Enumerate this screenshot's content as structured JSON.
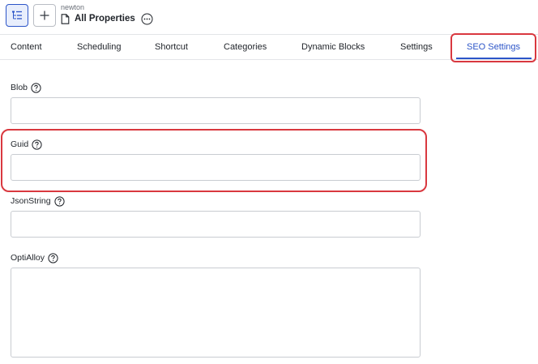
{
  "header": {
    "breadcrumb_parent": "newton",
    "page_title": "All Properties",
    "icons": {
      "tree": "tree-view-icon",
      "add": "plus-icon",
      "document": "document-icon",
      "more": "more-options-icon"
    }
  },
  "tabs": [
    {
      "label": "Content",
      "active": false
    },
    {
      "label": "Scheduling",
      "active": false
    },
    {
      "label": "Shortcut",
      "active": false
    },
    {
      "label": "Categories",
      "active": false
    },
    {
      "label": "Dynamic Blocks",
      "active": false
    },
    {
      "label": "Settings",
      "active": false
    },
    {
      "label": "SEO Settings",
      "active": true
    }
  ],
  "fields": [
    {
      "label": "Blob",
      "value": "",
      "placeholder": ""
    },
    {
      "label": "Guid",
      "value": "",
      "placeholder": ""
    },
    {
      "label": "JsonString",
      "value": "",
      "placeholder": ""
    },
    {
      "label": "OptiAlloy",
      "value": "",
      "placeholder": ""
    }
  ],
  "colors": {
    "accent": "#2c55c8",
    "highlight": "#d9383f",
    "border": "#c9ccd1"
  }
}
